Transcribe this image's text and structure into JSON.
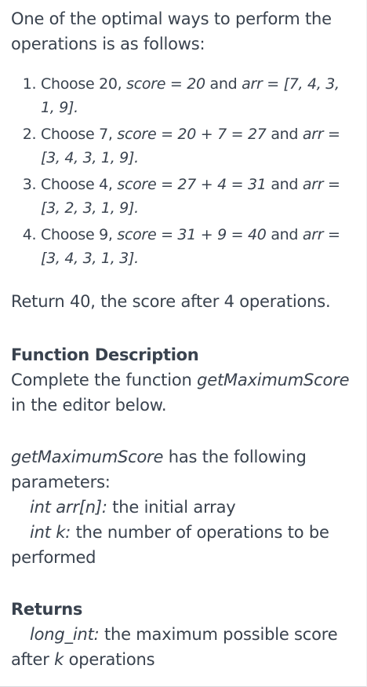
{
  "intro": "One of the optimal ways to perform the operations is as follows:",
  "steps": [
    {
      "lead": "Choose 20, ",
      "score": "score = 20",
      "mid": " and ",
      "arr": "arr = [7, 4, 3, 1, 9]",
      "end": "."
    },
    {
      "lead": "Choose 7, ",
      "score": "score = 20 + 7 = 27",
      "mid": " and ",
      "arr": "arr = [3, 4, 3, 1, 9]",
      "end": "."
    },
    {
      "lead": "Choose 4, ",
      "score": "score = 27 + 4 = 31",
      "mid": " and ",
      "arr": "arr = [3, 2, 3, 1, 9]",
      "end": "."
    },
    {
      "lead": "Choose 9, ",
      "score": "score = 31 + 9 = 40",
      "mid": " and ",
      "arr": "arr = [3, 4, 3, 1, 3]",
      "end": "."
    }
  ],
  "return_line": "Return 40, the score after 4 operations.",
  "function_description": {
    "heading": "Function Description",
    "text_before": "Complete the function ",
    "fn_name": "getMaximumScore",
    "text_after": " in the editor below."
  },
  "parameters": {
    "fn_name": "getMaximumScore",
    "text": " has the following parameters:",
    "items": [
      {
        "name": "int arr[n]:",
        "desc": " the initial array"
      },
      {
        "name": "int k:",
        "desc": " the number of operations to be performed"
      }
    ]
  },
  "returns": {
    "heading": "Returns",
    "type": "long_int:",
    "desc_before": " the maximum possible score after ",
    "var": "k",
    "desc_after": " operations"
  }
}
